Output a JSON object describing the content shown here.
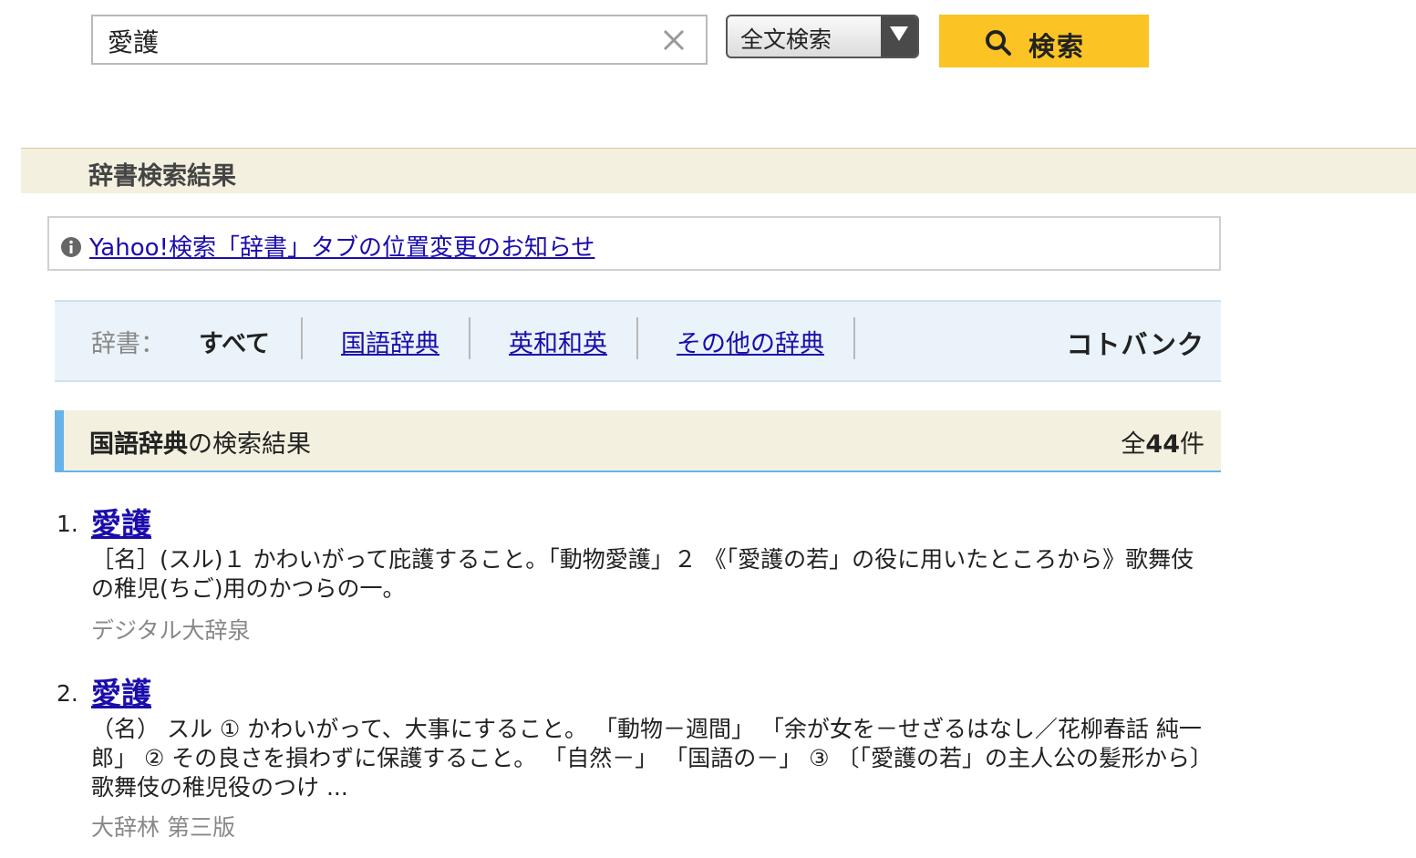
{
  "search": {
    "query": "愛護",
    "mode": "全文検索",
    "button_label": "検索"
  },
  "section": {
    "title": "辞書検索結果"
  },
  "notice": {
    "link_text": "Yahoo!検索「辞書」タブの位置変更のお知らせ"
  },
  "dictionary_tabs": {
    "label": "辞書：",
    "active": "すべて",
    "links": [
      "国語辞典",
      "英和和英",
      "その他の辞典"
    ],
    "brand": "コトバンク"
  },
  "results_header": {
    "dict_name": "国語辞典",
    "suffix": "の検索結果",
    "count_prefix": "全",
    "count": "44",
    "count_suffix": "件"
  },
  "results": [
    {
      "number": "1.",
      "title": "愛護",
      "snippet": "［名］(スル)１ かわいがって庇護すること。「動物愛護」２ 《「愛護の若」の役に用いたところから》歌舞伎の稚児(ちご)用のかつらの一。",
      "source": "デジタル大辞泉"
    },
    {
      "number": "2.",
      "title": "愛護",
      "snippet": "（名） スル ① かわいがって、大事にすること。 「動物－週間」 「余が女を－せざるはなし／花柳春話 純一郎」 ② その良さを損わずに保護すること。 「自然－」 「国語の－」 ③ 〔「愛護の若」の主人公の髪形から〕 歌舞伎の稚児役のつけ ...",
      "source": "大辞林 第三版"
    }
  ],
  "colors": {
    "link": "#1a0dab",
    "search_button": "#fbc424",
    "section_band": "#f3f0df",
    "dict_bar": "#e9f3f9",
    "accent_blue": "#67b2e9"
  }
}
